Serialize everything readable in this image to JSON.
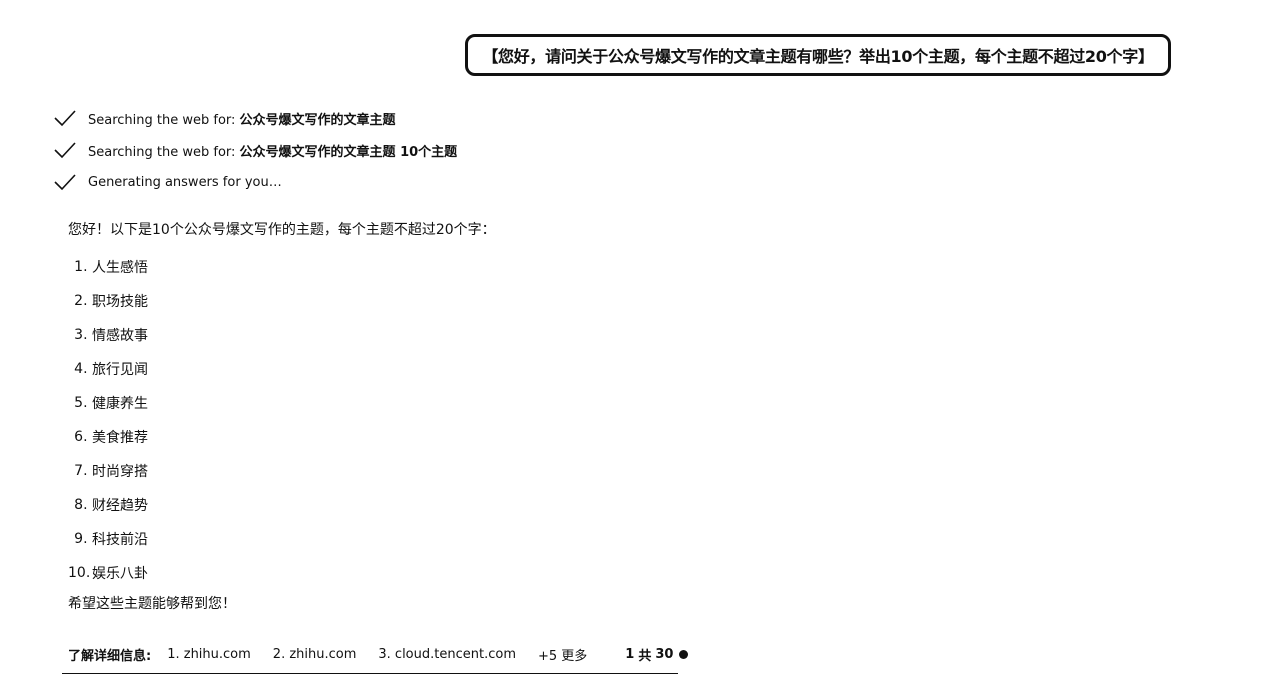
{
  "user_query": "【您好，请问关于公众号爆文写作的文章主题有哪些？举出10个主题，每个主题不超过20个字】",
  "steps": [
    {
      "icon": "checkmark-icon",
      "prefix": "Searching the web for: ",
      "query": "公众号爆文写作的文章主题"
    },
    {
      "icon": "checkmark-icon",
      "prefix": "Searching the web for: ",
      "query": "公众号爆文写作的文章主题 10个主题"
    },
    {
      "icon": "checkmark-icon",
      "prefix": "Generating answers for you…",
      "query": ""
    }
  ],
  "answer": {
    "intro": "您好！以下是10个公众号爆文写作的主题，每个主题不超过20个字：",
    "topics": [
      {
        "num": "1",
        "text": "人生感悟"
      },
      {
        "num": "2",
        "text": "职场技能"
      },
      {
        "num": "3",
        "text": "情感故事"
      },
      {
        "num": "4",
        "text": "旅行见闻"
      },
      {
        "num": "5",
        "text": "健康养生"
      },
      {
        "num": "6",
        "text": "美食推荐"
      },
      {
        "num": "7",
        "text": "时尚穿搭"
      },
      {
        "num": "8",
        "text": "财经趋势"
      },
      {
        "num": "9",
        "text": "科技前沿"
      },
      {
        "num": "10",
        "text": "娱乐八卦"
      }
    ],
    "closing": "希望这些主题能够帮到您！"
  },
  "sources": {
    "label": "了解详细信息:",
    "links": [
      "1. zhihu.com",
      "2. zhihu.com",
      "3. cloud.tencent.com"
    ],
    "more": "+5 更多",
    "counter_current": "1",
    "counter_sep": "共",
    "counter_total": "30"
  }
}
